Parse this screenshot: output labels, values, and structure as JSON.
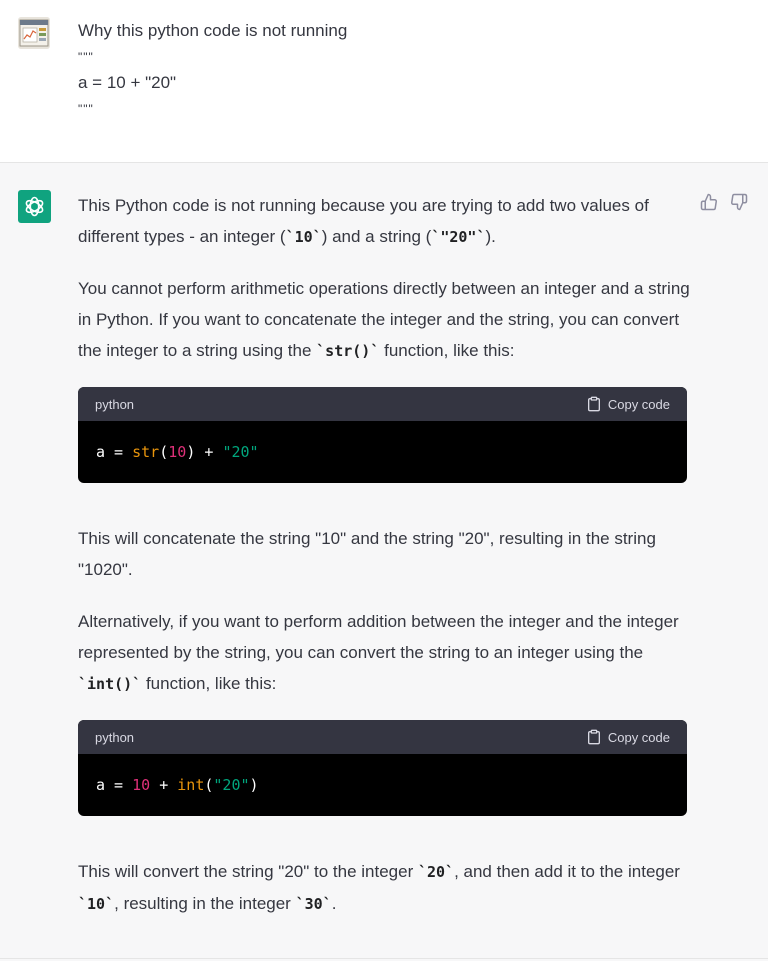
{
  "user": {
    "lines": [
      "Why this python code is not running",
      "\"\"\"",
      "a = 10 + \"20\"",
      "\"\"\""
    ],
    "avatar_icon": "user-avatar-image"
  },
  "assistant": {
    "avatar_icon": "openai-logo-icon",
    "feedback": {
      "up_icon": "thumbs-up-icon",
      "down_icon": "thumbs-down-icon"
    },
    "p1": {
      "before": "This Python code is not running because you are trying to add two values of different types - an integer (",
      "code1": "`10`",
      "mid": ") and a string (",
      "code2": "`\"20\"`",
      "after": ")."
    },
    "p2": {
      "before": "You cannot perform arithmetic operations directly between an integer and a string in Python. If you want to concatenate the integer and the string, you can convert the integer to a string using the ",
      "code": "`str()`",
      "after": " function, like this:"
    },
    "code_block_1": {
      "language": "python",
      "copy_label": "Copy code",
      "tokens": [
        "a",
        " = ",
        "str",
        "(",
        "10",
        ")",
        " + ",
        "\"20\""
      ]
    },
    "p3": "This will concatenate the string \"10\" and the string \"20\", resulting in the string \"1020\".",
    "p4": {
      "before": "Alternatively, if you want to perform addition between the integer and the integer represented by the string, you can convert the string to an integer using the ",
      "code": "`int()`",
      "after": " function, like this:"
    },
    "code_block_2": {
      "language": "python",
      "copy_label": "Copy code",
      "tokens": [
        "a",
        " = ",
        "10",
        " + ",
        "int",
        "(",
        "\"20\"",
        ")"
      ]
    },
    "p5": {
      "before": "This will convert the string \"20\" to the integer ",
      "code1": "`20`",
      "mid": ", and then add it to the integer ",
      "code2": "`10`",
      "mid2": ", resulting in the integer ",
      "code3": "`30`",
      "after": "."
    }
  }
}
